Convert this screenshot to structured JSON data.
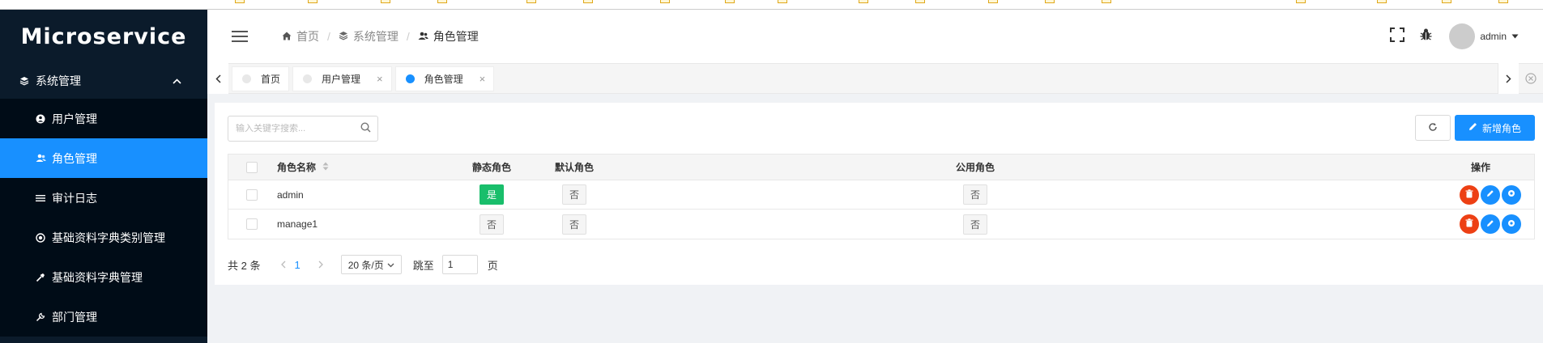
{
  "app": {
    "logo": "Microservice"
  },
  "sidebar": {
    "group": {
      "label": "系统管理",
      "icon": "layers-icon"
    },
    "items": [
      {
        "label": "用户管理",
        "icon": "user-circle-icon",
        "active": false
      },
      {
        "label": "角色管理",
        "icon": "users-icon",
        "active": true
      },
      {
        "label": "审计日志",
        "icon": "list-icon",
        "active": false
      },
      {
        "label": "基础资料字典类别管理",
        "icon": "settings-circle-icon",
        "active": false
      },
      {
        "label": "基础资料字典管理",
        "icon": "hammer-icon",
        "active": false
      },
      {
        "label": "部门管理",
        "icon": "wrench-icon",
        "active": false
      }
    ]
  },
  "header": {
    "breadcrumb": [
      {
        "label": "首页",
        "icon": "home-icon"
      },
      {
        "label": "系统管理",
        "icon": "layers-icon"
      },
      {
        "label": "角色管理",
        "icon": "users-icon"
      }
    ],
    "user": {
      "name": "admin"
    }
  },
  "tabs": [
    {
      "label": "首页",
      "active": false,
      "closable": false
    },
    {
      "label": "用户管理",
      "active": false,
      "closable": true
    },
    {
      "label": "角色管理",
      "active": true,
      "closable": true
    }
  ],
  "toolbar": {
    "search_placeholder": "输入关键字搜索...",
    "add_label": "新增角色"
  },
  "table": {
    "columns": [
      "角色名称",
      "静态角色",
      "默认角色",
      "公用角色",
      "操作"
    ],
    "rows": [
      {
        "name": "admin",
        "static": "是",
        "default": "否",
        "public": "否"
      },
      {
        "name": "manage1",
        "static": "否",
        "default": "否",
        "public": "否"
      }
    ]
  },
  "pager": {
    "total_text": "共 2 条",
    "current_page": "1",
    "page_size": "20 条/页",
    "jump_label": "跳至",
    "jump_value": "1",
    "page_suffix": "页"
  },
  "colors": {
    "sidebar_bg": "#0b1b2b",
    "accent": "#1890ff",
    "success": "#19be6b",
    "danger": "#ed4014"
  }
}
